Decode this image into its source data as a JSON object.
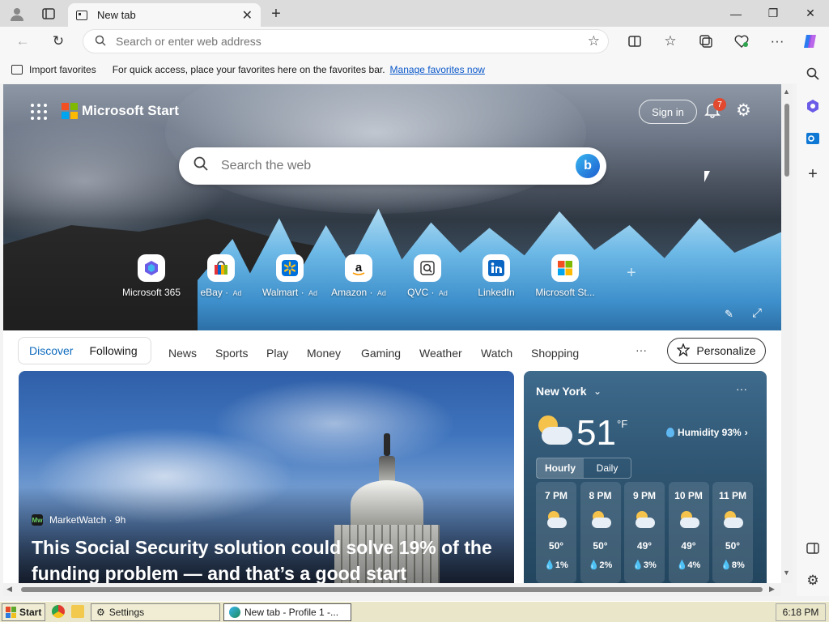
{
  "browser": {
    "tab": {
      "title": "New tab"
    },
    "address": {
      "placeholder": "Search or enter web address"
    },
    "favorites_bar": {
      "import_label": "Import favorites",
      "hint": "For quick access, place your favorites here on the favorites bar.",
      "manage_link": "Manage favorites now"
    }
  },
  "page": {
    "brand": "Microsoft Start",
    "sign_in": "Sign in",
    "notification_count": "7",
    "search_placeholder": "Search the web",
    "quick_links": [
      {
        "label": "Microsoft 365",
        "ad": "",
        "icon": "microsoft-365-icon"
      },
      {
        "label": "eBay",
        "ad": "Ad",
        "icon": "ebay-icon"
      },
      {
        "label": "Walmart",
        "ad": "Ad",
        "icon": "walmart-icon"
      },
      {
        "label": "Amazon",
        "ad": "Ad",
        "icon": "amazon-icon"
      },
      {
        "label": "QVC",
        "ad": "Ad",
        "icon": "qvc-icon"
      },
      {
        "label": "LinkedIn",
        "ad": "",
        "icon": "linkedin-icon"
      },
      {
        "label": "Microsoft St...",
        "ad": "",
        "icon": "microsoft-store-icon"
      }
    ],
    "feed_tabs": {
      "primary": [
        "Discover",
        "Following"
      ],
      "sections": [
        "News",
        "Sports",
        "Play",
        "Money",
        "Gaming",
        "Weather",
        "Watch",
        "Shopping"
      ],
      "more": "···",
      "personalize": "Personalize"
    },
    "news": {
      "source": "MarketWatch · 9h",
      "headline": "This Social Security solution could solve 19% of the funding problem — and that’s a good start"
    },
    "weather": {
      "city": "New York",
      "temp": "51",
      "unit": "°F",
      "humidity": "Humidity 93%",
      "tabs": [
        "Hourly",
        "Daily"
      ],
      "hours": [
        {
          "time": "7 PM",
          "temp": "50°",
          "rain": "1%"
        },
        {
          "time": "8 PM",
          "temp": "50°",
          "rain": "2%"
        },
        {
          "time": "9 PM",
          "temp": "49°",
          "rain": "3%"
        },
        {
          "time": "10 PM",
          "temp": "49°",
          "rain": "4%"
        },
        {
          "time": "11 PM",
          "temp": "50°",
          "rain": "8%"
        }
      ]
    }
  },
  "taskbar": {
    "start": "Start",
    "items": [
      "Settings",
      "New tab - Profile 1 -..."
    ],
    "clock": "6:18 PM"
  },
  "colors": {
    "accent": "#0f6cbd",
    "link": "#0a58ca",
    "badge": "#e2492f"
  }
}
